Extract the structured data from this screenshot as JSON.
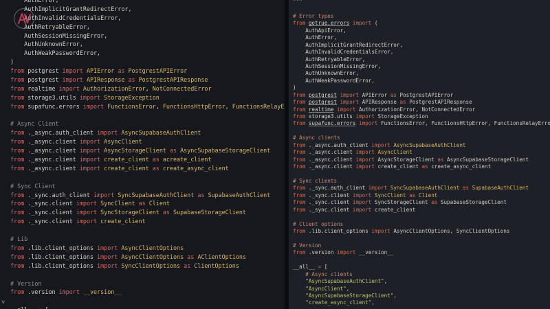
{
  "logo": {
    "glyph": "AV"
  },
  "gutter": {
    "chevron": "˅"
  },
  "left": [
    [
      [
        "pl",
        "    AuthError,"
      ]
    ],
    [
      [
        "pl",
        "    AuthImplicitGrantRedirectError,"
      ]
    ],
    [
      [
        "pl",
        "    AuthInvalidCredentialsError,"
      ]
    ],
    [
      [
        "pl",
        "    AuthRetryableError,"
      ]
    ],
    [
      [
        "pl",
        "    AuthSessionMissingError,"
      ]
    ],
    [
      [
        "pl",
        "    AuthUnknownError,"
      ]
    ],
    [
      [
        "pl",
        "    AuthWeakPasswordError,"
      ]
    ],
    [
      [
        "pl",
        ")"
      ]
    ],
    [
      [
        "kw",
        "from "
      ],
      [
        "mod",
        "postgrest "
      ],
      [
        "kw",
        "import "
      ],
      [
        "name-y",
        "APIError "
      ],
      [
        "kw",
        "as "
      ],
      [
        "name-y",
        "PostgrestAPIError"
      ]
    ],
    [
      [
        "kw",
        "from "
      ],
      [
        "mod",
        "postgrest "
      ],
      [
        "kw",
        "import "
      ],
      [
        "name-y",
        "APIResponse "
      ],
      [
        "kw",
        "as "
      ],
      [
        "name-y",
        "PostgrestAPIResponse"
      ]
    ],
    [
      [
        "kw",
        "from "
      ],
      [
        "mod",
        "realtime "
      ],
      [
        "kw",
        "import "
      ],
      [
        "name-y",
        "AuthorizationError"
      ],
      [
        "pl",
        ", "
      ],
      [
        "name-y",
        "NotConnectedError"
      ]
    ],
    [
      [
        "kw",
        "from "
      ],
      [
        "mod",
        "storage3.utils "
      ],
      [
        "kw",
        "import "
      ],
      [
        "name-y",
        "StorageException"
      ]
    ],
    [
      [
        "kw",
        "from "
      ],
      [
        "mod",
        "supafunc.errors "
      ],
      [
        "kw",
        "import "
      ],
      [
        "name-y",
        "FunctionsError"
      ],
      [
        "pl",
        ", "
      ],
      [
        "name-y",
        "FunctionsHttpError"
      ],
      [
        "pl",
        ", "
      ],
      [
        "name-y",
        "FunctionsRelayError"
      ]
    ],
    [],
    [
      [
        "cmt",
        "# Async Client"
      ]
    ],
    [
      [
        "kw",
        "from "
      ],
      [
        "mod",
        "._async.auth_client "
      ],
      [
        "kw",
        "import "
      ],
      [
        "name-y",
        "AsyncSupabaseAuthClient"
      ]
    ],
    [
      [
        "kw",
        "from "
      ],
      [
        "mod",
        "._async.client "
      ],
      [
        "kw",
        "import "
      ],
      [
        "name-y",
        "AsyncClient"
      ]
    ],
    [
      [
        "kw",
        "from "
      ],
      [
        "mod",
        "._async.client "
      ],
      [
        "kw",
        "import "
      ],
      [
        "name-y",
        "AsyncStorageClient "
      ],
      [
        "kw",
        "as "
      ],
      [
        "name-y",
        "AsyncSupabaseStorageClient"
      ]
    ],
    [
      [
        "kw",
        "from "
      ],
      [
        "mod",
        "._async.client "
      ],
      [
        "kw",
        "import "
      ],
      [
        "name-y",
        "create_client "
      ],
      [
        "kw",
        "as "
      ],
      [
        "name-y",
        "acreate_client"
      ]
    ],
    [
      [
        "kw",
        "from "
      ],
      [
        "mod",
        "._async.client "
      ],
      [
        "kw",
        "import "
      ],
      [
        "name-y",
        "create_client "
      ],
      [
        "kw",
        "as "
      ],
      [
        "name-y",
        "create_async_client"
      ]
    ],
    [],
    [
      [
        "cmt",
        "# Sync Client"
      ]
    ],
    [
      [
        "kw",
        "from "
      ],
      [
        "mod",
        "._sync.auth_client "
      ],
      [
        "kw",
        "import "
      ],
      [
        "name-y",
        "SyncSupabaseAuthClient "
      ],
      [
        "kw",
        "as "
      ],
      [
        "name-y",
        "SupabaseAuthClient"
      ]
    ],
    [
      [
        "kw",
        "from "
      ],
      [
        "mod",
        "._sync.client "
      ],
      [
        "kw",
        "import "
      ],
      [
        "name-y",
        "SyncClient "
      ],
      [
        "kw",
        "as "
      ],
      [
        "name-y",
        "Client"
      ]
    ],
    [
      [
        "kw",
        "from "
      ],
      [
        "mod",
        "._sync.client "
      ],
      [
        "kw",
        "import "
      ],
      [
        "name-y",
        "SyncStorageClient "
      ],
      [
        "kw",
        "as "
      ],
      [
        "name-y",
        "SupabaseStorageClient"
      ]
    ],
    [
      [
        "kw",
        "from "
      ],
      [
        "mod",
        "._sync.client "
      ],
      [
        "kw",
        "import "
      ],
      [
        "name-y",
        "create_client"
      ]
    ],
    [],
    [
      [
        "cmt",
        "# Lib"
      ]
    ],
    [
      [
        "kw",
        "from "
      ],
      [
        "mod",
        ".lib.client_options "
      ],
      [
        "kw",
        "import "
      ],
      [
        "name-y",
        "AsyncClientOptions"
      ]
    ],
    [
      [
        "kw",
        "from "
      ],
      [
        "mod",
        ".lib.client_options "
      ],
      [
        "kw",
        "import "
      ],
      [
        "name-y",
        "AsyncClientOptions "
      ],
      [
        "kw",
        "as "
      ],
      [
        "name-y",
        "AClientOptions"
      ]
    ],
    [
      [
        "kw",
        "from "
      ],
      [
        "mod",
        ".lib.client_options "
      ],
      [
        "kw",
        "import "
      ],
      [
        "name-y",
        "SyncClientOptions "
      ],
      [
        "kw",
        "as "
      ],
      [
        "name-y",
        "ClientOptions"
      ]
    ],
    [],
    [
      [
        "cmt",
        "# Version"
      ]
    ],
    [
      [
        "kw",
        "from "
      ],
      [
        "mod",
        ".version "
      ],
      [
        "kw",
        "import "
      ],
      [
        "name-y",
        "__version__"
      ]
    ],
    [],
    [
      [
        "pl",
        "__all__ "
      ],
      [
        "kw",
        "= "
      ],
      [
        "pl",
        "["
      ]
    ]
  ],
  "right": [
    [
      [
        "cmt",
        "\"\"\""
      ]
    ],
    [],
    [
      [
        "cmt-r",
        "# Error types"
      ]
    ],
    [
      [
        "kw-r",
        "from "
      ],
      [
        "mod",
        "gotrue.errors",
        "ul"
      ],
      [
        "pl-r",
        " "
      ],
      [
        "kw-r",
        "import "
      ],
      [
        "pl-r",
        "("
      ]
    ],
    [
      [
        "pl-r",
        "    AuthApiError,"
      ]
    ],
    [
      [
        "pl-r",
        "    AuthError,"
      ]
    ],
    [
      [
        "pl-r",
        "    AuthImplicitGrantRedirectError,"
      ]
    ],
    [
      [
        "pl-r",
        "    AuthInvalidCredentialsError,"
      ]
    ],
    [
      [
        "pl-r",
        "    AuthRetryableError,"
      ]
    ],
    [
      [
        "pl-r",
        "    AuthSessionMissingError,"
      ]
    ],
    [
      [
        "pl-r",
        "    AuthUnknownError,"
      ]
    ],
    [
      [
        "pl-r",
        "    AuthWeakPasswordError,"
      ]
    ],
    [
      [
        "pl-r",
        ")"
      ]
    ],
    [
      [
        "kw-r",
        "from "
      ],
      [
        "mod",
        "postgrest",
        "ul"
      ],
      [
        "pl-r",
        " "
      ],
      [
        "kw-r",
        "import "
      ],
      [
        "name-r",
        "APIError "
      ],
      [
        "kw-r",
        "as "
      ],
      [
        "name-r",
        "PostgrestAPIError"
      ]
    ],
    [
      [
        "kw-r",
        "from "
      ],
      [
        "mod",
        "postgrest",
        "ul"
      ],
      [
        "pl-r",
        " "
      ],
      [
        "kw-r",
        "import "
      ],
      [
        "name-r",
        "APIResponse "
      ],
      [
        "kw-r",
        "as "
      ],
      [
        "name-r",
        "PostgrestAPIResponse"
      ]
    ],
    [
      [
        "kw-r",
        "from "
      ],
      [
        "mod",
        "realtime",
        "ul"
      ],
      [
        "pl-r",
        " "
      ],
      [
        "kw-r",
        "import "
      ],
      [
        "name-r",
        "AuthorizationError, NotConnectedError"
      ]
    ],
    [
      [
        "kw-r",
        "from "
      ],
      [
        "mod",
        "storage3.utils"
      ],
      [
        "pl-r",
        " "
      ],
      [
        "kw-r",
        "import "
      ],
      [
        "name-r",
        "StorageException"
      ]
    ],
    [
      [
        "kw-r",
        "from "
      ],
      [
        "mod",
        "supafunc.errors",
        "ul"
      ],
      [
        "pl-r",
        " "
      ],
      [
        "kw-r",
        "import "
      ],
      [
        "name-r",
        "FunctionsError, FunctionsHttpError, FunctionsRelayError"
      ]
    ],
    [],
    [
      [
        "cmt-r",
        "# Async clients"
      ]
    ],
    [
      [
        "kw-r",
        "from "
      ],
      [
        "mod",
        "._async.auth_client "
      ],
      [
        "kw-r",
        "import "
      ],
      [
        "cls-r",
        "AsyncSupabaseAuthClient"
      ]
    ],
    [
      [
        "kw-r",
        "from "
      ],
      [
        "mod",
        "._async.client "
      ],
      [
        "kw-r",
        "import "
      ],
      [
        "cls-r",
        "AsyncClient"
      ]
    ],
    [
      [
        "kw-r",
        "from "
      ],
      [
        "mod",
        "._async.client "
      ],
      [
        "kw-r",
        "import "
      ],
      [
        "name-r",
        "AsyncStorageClient "
      ],
      [
        "kw-r",
        "as "
      ],
      [
        "name-r",
        "AsyncSupabaseStorageClient"
      ]
    ],
    [
      [
        "kw-r",
        "from "
      ],
      [
        "mod",
        "._async.client "
      ],
      [
        "kw-r",
        "import "
      ],
      [
        "name-r",
        "create_client "
      ],
      [
        "kw-r",
        "as "
      ],
      [
        "name-r",
        "create_async_client"
      ]
    ],
    [],
    [
      [
        "cmt-r",
        "# Sync clients"
      ]
    ],
    [
      [
        "kw-r",
        "from "
      ],
      [
        "mod",
        "._sync.auth_client "
      ],
      [
        "kw-r",
        "import "
      ],
      [
        "cls-r",
        "SyncSupabaseAuthClient "
      ],
      [
        "kw-r",
        "as "
      ],
      [
        "cls-r",
        "SupabaseAuthClient"
      ]
    ],
    [
      [
        "kw-r",
        "from "
      ],
      [
        "mod",
        "._sync.client "
      ],
      [
        "kw-r",
        "import "
      ],
      [
        "cls-r",
        "SyncClient "
      ],
      [
        "kw-r",
        "as "
      ],
      [
        "cls-r",
        "Client"
      ]
    ],
    [
      [
        "kw-r",
        "from "
      ],
      [
        "mod",
        "._sync.client "
      ],
      [
        "kw-r",
        "import "
      ],
      [
        "name-r",
        "SyncStorageClient "
      ],
      [
        "kw-r",
        "as "
      ],
      [
        "name-r",
        "SupabaseStorageClient"
      ]
    ],
    [
      [
        "kw-r",
        "from "
      ],
      [
        "mod",
        "._sync.client "
      ],
      [
        "kw-r",
        "import "
      ],
      [
        "name-r",
        "create_client"
      ]
    ],
    [],
    [
      [
        "cmt-r",
        "# Client options"
      ]
    ],
    [
      [
        "kw-r",
        "from "
      ],
      [
        "mod",
        ".lib.client_options "
      ],
      [
        "kw-r",
        "import "
      ],
      [
        "name-r",
        "AsyncClientOptions, SyncClientOptions"
      ]
    ],
    [],
    [
      [
        "cmt-r",
        "# Version"
      ]
    ],
    [
      [
        "kw-r",
        "from "
      ],
      [
        "mod",
        ".version "
      ],
      [
        "kw-r",
        "import "
      ],
      [
        "name-r",
        "__version__"
      ]
    ],
    [],
    [
      [
        "pl-r",
        "__all__ "
      ],
      [
        "kw-r",
        "= "
      ],
      [
        "pl-r",
        "["
      ]
    ],
    [
      [
        "cmt-r",
        "    # Async clients"
      ]
    ],
    [
      [
        "str",
        "    \"AsyncSupabaseAuthClient\""
      ],
      [
        "pl-r",
        ","
      ]
    ],
    [
      [
        "str",
        "    \"AsyncClient\""
      ],
      [
        "pl-r",
        ","
      ]
    ],
    [
      [
        "str",
        "    \"AsyncSupabaseStorageClient\""
      ],
      [
        "pl-r",
        ","
      ]
    ],
    [
      [
        "str",
        "    \"create_async_client\""
      ],
      [
        "pl-r",
        ","
      ]
    ]
  ]
}
